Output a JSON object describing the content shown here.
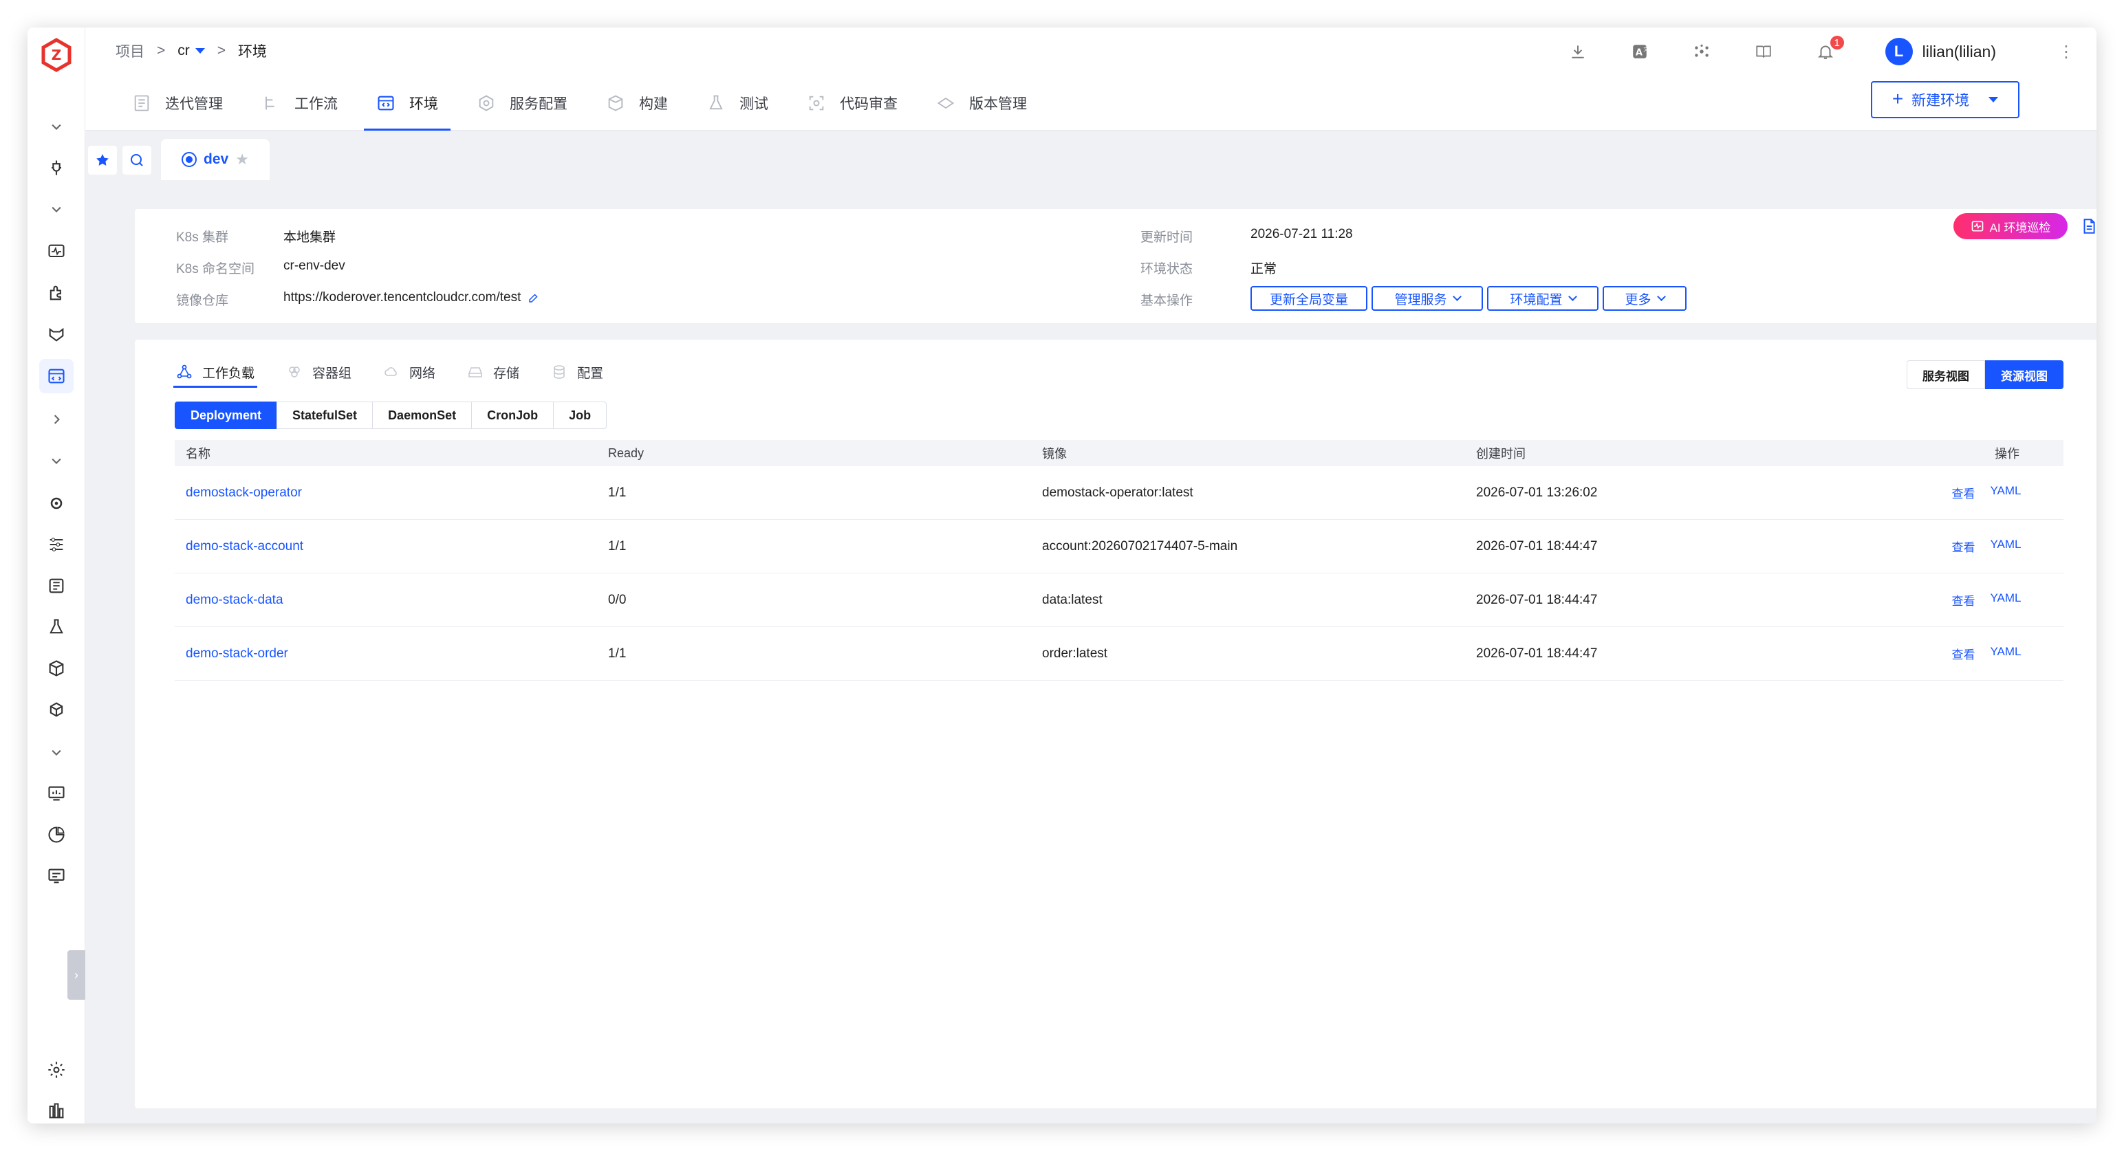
{
  "breadcrumb": {
    "root": "项目",
    "sep1": ">",
    "project": "cr",
    "sep2": ">",
    "current": "环境"
  },
  "top_icons": [
    "download-icon",
    "translate-icon",
    "hub-icon",
    "book-icon",
    "bell-icon"
  ],
  "notifications": {
    "count": "1"
  },
  "user": {
    "initial": "L",
    "name": "lilian(lilian)"
  },
  "nav_tabs": [
    {
      "label": "迭代管理",
      "icon": "iteration-icon"
    },
    {
      "label": "工作流",
      "icon": "workflow-icon"
    },
    {
      "label": "环境",
      "icon": "environment-icon",
      "active": true
    },
    {
      "label": "服务配置",
      "icon": "service-config-icon"
    },
    {
      "label": "构建",
      "icon": "build-icon"
    },
    {
      "label": "测试",
      "icon": "test-icon"
    },
    {
      "label": "代码审查",
      "icon": "code-scan-icon"
    },
    {
      "label": "版本管理",
      "icon": "version-icon"
    }
  ],
  "new_env_button": "新建环境",
  "env_tab": {
    "name": "dev",
    "star": "★"
  },
  "env_info": {
    "k8s_cluster_label": "K8s 集群",
    "k8s_cluster_value": "本地集群",
    "k8s_namespace_label": "K8s 命名空间",
    "k8s_namespace_value": "cr-env-dev",
    "registry_label": "镜像仓库",
    "registry_value": "https://koderover.tencentcloudcr.com/test",
    "updated_label": "更新时间",
    "updated_value": "2026-07-21 11:28",
    "status_label": "环境状态",
    "status_value": "正常",
    "ops_label": "基本操作"
  },
  "ops_buttons": {
    "update_vars": "更新全局变量",
    "manage_services": "管理服务",
    "env_config": "环境配置",
    "more": "更多"
  },
  "ai_badge": "AI 环境巡检",
  "workload_tabs": [
    {
      "label": "工作负载",
      "icon": "workload-icon",
      "active": true
    },
    {
      "label": "容器组",
      "icon": "pod-icon"
    },
    {
      "label": "网络",
      "icon": "network-icon"
    },
    {
      "label": "存储",
      "icon": "storage-icon"
    },
    {
      "label": "配置",
      "icon": "config-icon"
    }
  ],
  "view_switch": {
    "service_view": "服务视图",
    "resource_view": "资源视图",
    "active": "resource_view"
  },
  "kind_tabs": [
    "Deployment",
    "StatefulSet",
    "DaemonSet",
    "CronJob",
    "Job"
  ],
  "table": {
    "headers": {
      "name": "名称",
      "ready": "Ready",
      "image": "镜像",
      "created": "创建时间",
      "actions": "操作"
    },
    "rows": [
      {
        "name": "demostack-operator",
        "ready": "1/1",
        "image": "demostack-operator:latest",
        "created": "2026-07-01 13:26:02",
        "view": "查看",
        "yaml": "YAML"
      },
      {
        "name": "demo-stack-account",
        "ready": "1/1",
        "image": "account:20260702174407-5-main",
        "created": "2026-07-01 18:44:47",
        "view": "查看",
        "yaml": "YAML"
      },
      {
        "name": "demo-stack-data",
        "ready": "0/0",
        "image": "data:latest",
        "created": "2026-07-01 18:44:47",
        "view": "查看",
        "yaml": "YAML"
      },
      {
        "name": "demo-stack-order",
        "ready": "1/1",
        "image": "order:latest",
        "created": "2026-07-01 18:44:47",
        "view": "查看",
        "yaml": "YAML"
      }
    ]
  },
  "colors": {
    "primary": "#1855ff",
    "badge_red": "#f04a4a",
    "ai_gradient_start": "#ff2f6d",
    "ai_gradient_end": "#d628e8"
  }
}
